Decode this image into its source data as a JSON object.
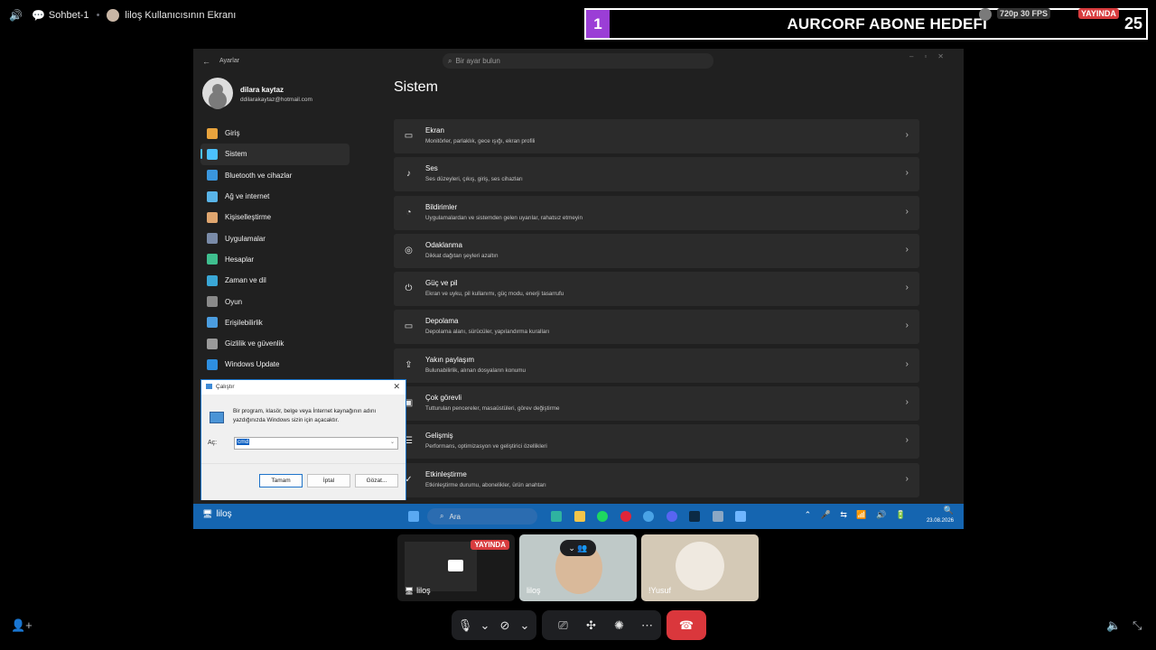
{
  "topbar": {
    "channel": "Sohbet-1",
    "screen_title": "liloş Kullanıcısının Ekranı"
  },
  "banner": {
    "number": "1",
    "title": "AURCORF ABONE HEDEFI",
    "quality": "720p 30 FPS",
    "live": "YAYINDA",
    "count": "25"
  },
  "settings": {
    "app_title": "Ayarlar",
    "search_placeholder": "Bir ayar bulun",
    "user_name": "dilara kaytaz",
    "user_email": "ddilarakaytaz@hotmail.com",
    "heading": "Sistem",
    "nav": [
      {
        "label": "Giriş",
        "color": "#e8a33d",
        "selected": false
      },
      {
        "label": "Sistem",
        "color": "#4cc2ff",
        "selected": true
      },
      {
        "label": "Bluetooth ve cihazlar",
        "color": "#3a96dd",
        "selected": false
      },
      {
        "label": "Ağ ve internet",
        "color": "#59b4e8",
        "selected": false
      },
      {
        "label": "Kişiselleştirme",
        "color": "#e0a66f",
        "selected": false
      },
      {
        "label": "Uygulamalar",
        "color": "#7a8ba8",
        "selected": false
      },
      {
        "label": "Hesaplar",
        "color": "#3fbf8f",
        "selected": false
      },
      {
        "label": "Zaman ve dil",
        "color": "#3aa7d6",
        "selected": false
      },
      {
        "label": "Oyun",
        "color": "#8a8a8a",
        "selected": false
      },
      {
        "label": "Erişilebilirlik",
        "color": "#4b9de0",
        "selected": false
      },
      {
        "label": "Gizlilik ve güvenlik",
        "color": "#9a9a9a",
        "selected": false
      },
      {
        "label": "Windows Update",
        "color": "#2e8fe0",
        "selected": false
      }
    ],
    "cards": [
      {
        "title": "Ekran",
        "sub": "Monitörler, parlaklık, gece ışığı, ekran profili",
        "icon": "▭"
      },
      {
        "title": "Ses",
        "sub": "Ses düzeyleri, çıkış, giriş, ses cihazları",
        "icon": "♪"
      },
      {
        "title": "Bildirimler",
        "sub": "Uygulamalardan ve sistemden gelen uyarılar, rahatsız etmeyin",
        "icon": "◔"
      },
      {
        "title": "Odaklanma",
        "sub": "Dikkat dağıtan şeyleri azaltın",
        "icon": "◎"
      },
      {
        "title": "Güç ve pil",
        "sub": "Ekran ve uyku, pil kullanımı, güç modu, enerji tasarrufu",
        "icon": "⏻"
      },
      {
        "title": "Depolama",
        "sub": "Depolama alanı, sürücüler, yapılandırma kuralları",
        "icon": "▭"
      },
      {
        "title": "Yakın paylaşım",
        "sub": "Bulunabilirlik, alınan dosyaların konumu",
        "icon": "⇪"
      },
      {
        "title": "Çok görevli",
        "sub": "Tutturulan pencereler, masaüstüleri, görev değiştirme",
        "icon": "▣"
      },
      {
        "title": "Gelişmiş",
        "sub": "Performans, optimizasyon ve geliştirici özellikleri",
        "icon": "☰"
      },
      {
        "title": "Etkinleştirme",
        "sub": "Etkinleştirme durumu, abonelikler, ürün anahtarı",
        "icon": "✓"
      }
    ]
  },
  "run_dialog": {
    "title": "Çalıştır",
    "message": "Bir program, klasör, belge veya İnternet kaynağının adını yazdığınızda Windows sizin için açacaktır.",
    "open_label": "Aç:",
    "value": "cmd",
    "ok": "Tamam",
    "cancel": "İptal",
    "browse": "Gözat..."
  },
  "taskbar": {
    "search": "Ara",
    "date": "23.08.2026",
    "icons": [
      {
        "name": "edge",
        "color": "#2fb3a0"
      },
      {
        "name": "explorer",
        "color": "#f2c54a"
      },
      {
        "name": "spotify",
        "color": "#1ed760"
      },
      {
        "name": "opera",
        "color": "#e0263a"
      },
      {
        "name": "vpn",
        "color": "#4aa3e6"
      },
      {
        "name": "discord",
        "color": "#5865f2"
      },
      {
        "name": "steam",
        "color": "#0b2a45"
      },
      {
        "name": "settings",
        "color": "#8ba7c4"
      },
      {
        "name": "active-window",
        "color": "#6fb6ff"
      }
    ]
  },
  "stream_label": "liloş",
  "participants": [
    {
      "name": "liloş",
      "live": "YAYINDA"
    },
    {
      "name": "liloş"
    },
    {
      "name": "!Yusuf"
    }
  ]
}
